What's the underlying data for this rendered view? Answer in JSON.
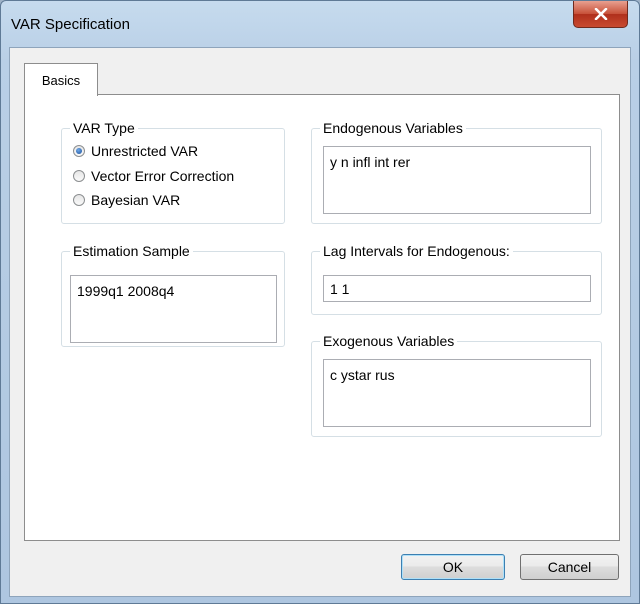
{
  "window": {
    "title": "VAR Specification"
  },
  "tabs": [
    {
      "label": "Basics"
    }
  ],
  "var_type": {
    "label": "VAR Type",
    "options": [
      {
        "label": "Unrestricted VAR",
        "selected": true
      },
      {
        "label": "Vector Error Correction",
        "selected": false
      },
      {
        "label": "Bayesian VAR",
        "selected": false
      }
    ]
  },
  "endogenous": {
    "label": "Endogenous Variables",
    "value": "y n infl int rer"
  },
  "estimation_sample": {
    "label": "Estimation Sample",
    "value": "1999q1 2008q4"
  },
  "lag_intervals": {
    "label": "Lag Intervals for Endogenous:",
    "value": "1 1"
  },
  "exogenous": {
    "label": "Exogenous Variables",
    "value": "c ystar rus"
  },
  "buttons": {
    "ok": "OK",
    "cancel": "Cancel"
  },
  "icons": {
    "close": "close-icon"
  }
}
